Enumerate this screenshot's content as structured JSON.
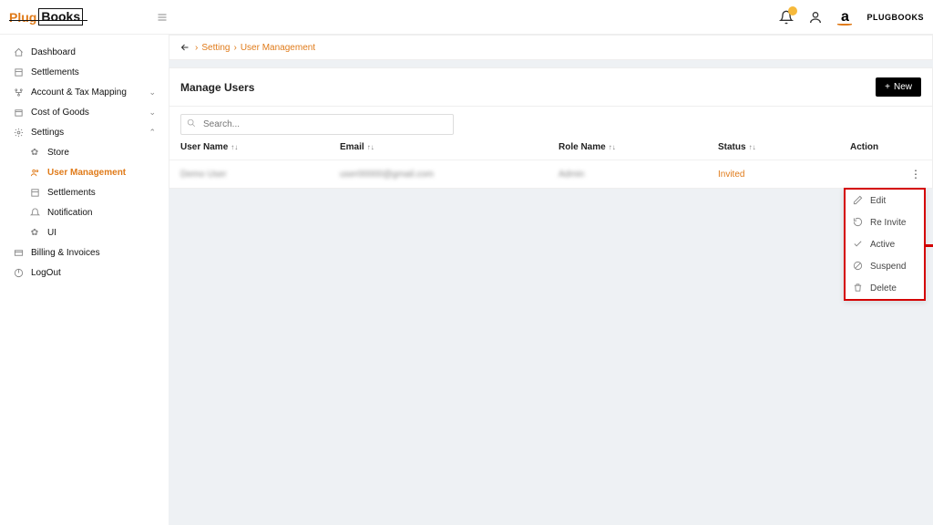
{
  "brand": {
    "part1": "Plug",
    "part2": "Books"
  },
  "tenant": "PLUGBOOKS",
  "sidebar": {
    "items": [
      {
        "label": "Dashboard"
      },
      {
        "label": "Settlements"
      },
      {
        "label": "Account & Tax Mapping"
      },
      {
        "label": "Cost of Goods"
      },
      {
        "label": "Settings"
      },
      {
        "label": "Billing & Invoices"
      },
      {
        "label": "LogOut"
      }
    ],
    "settings_children": [
      {
        "label": "Store"
      },
      {
        "label": "User Management"
      },
      {
        "label": "Settlements"
      },
      {
        "label": "Notification"
      },
      {
        "label": "UI"
      }
    ]
  },
  "breadcrumb": {
    "a": "Setting",
    "b": "User Management"
  },
  "panel": {
    "title": "Manage Users",
    "new_label": "New"
  },
  "search": {
    "placeholder": "Search..."
  },
  "columns": {
    "user": "User Name",
    "email": "Email",
    "role": "Role Name",
    "status": "Status",
    "action": "Action"
  },
  "row": {
    "user": "Demo User",
    "email": "user00000@gmail.com",
    "role": "Admin",
    "status": "Invited"
  },
  "popover": {
    "edit": "Edit",
    "reinvite": "Re Invite",
    "active": "Active",
    "suspend": "Suspend",
    "delete": "Delete"
  }
}
